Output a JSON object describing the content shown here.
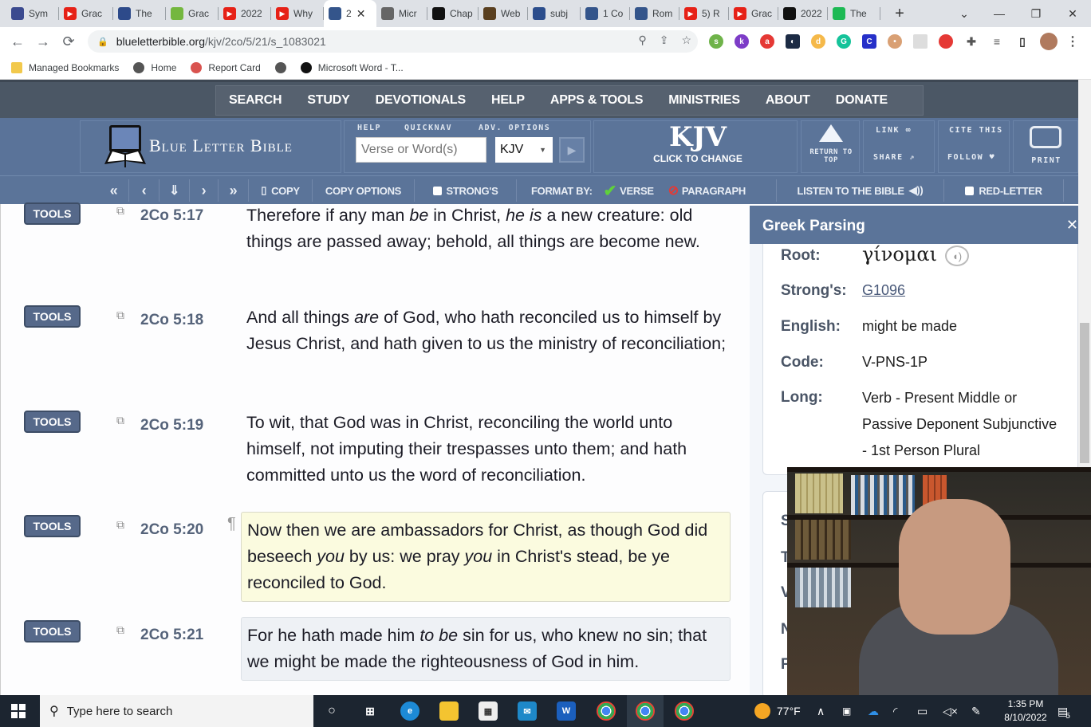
{
  "browser": {
    "tabs": [
      {
        "label": "Sym",
        "icon": "app-icon",
        "color": "#3b4a8f"
      },
      {
        "label": "Grac",
        "icon": "youtube-icon",
        "color": "#e62117"
      },
      {
        "label": "The",
        "icon": "site-icon",
        "color": "#2d4a8a"
      },
      {
        "label": "Grac",
        "icon": "rumble-icon",
        "color": "#74b73f"
      },
      {
        "label": "2022",
        "icon": "youtube-icon",
        "color": "#e62117"
      },
      {
        "label": "Why",
        "icon": "youtube-icon",
        "color": "#e62117"
      },
      {
        "label": "2",
        "icon": "blb-icon",
        "color": "#34558b",
        "active": true
      },
      {
        "label": "Micr",
        "icon": "globe-icon",
        "color": "#666"
      },
      {
        "label": "Chap",
        "icon": "doc-icon",
        "color": "#111"
      },
      {
        "label": "Web",
        "icon": "portrait-icon",
        "color": "#5a4020"
      },
      {
        "label": "subj",
        "icon": "o-icon",
        "color": "#2b4d8c"
      },
      {
        "label": "1 Co",
        "icon": "blb-icon",
        "color": "#34558b"
      },
      {
        "label": "Rom",
        "icon": "blb-icon",
        "color": "#34558b"
      },
      {
        "label": "5) R",
        "icon": "youtube-icon",
        "color": "#e62117"
      },
      {
        "label": "Grac",
        "icon": "youtube-icon",
        "color": "#e62117"
      },
      {
        "label": "2022",
        "icon": "doc-icon",
        "color": "#111"
      },
      {
        "label": "The",
        "icon": "spotify-icon",
        "color": "#1db954"
      }
    ],
    "new_tab": "+",
    "url_host": "blueletterbible.org",
    "url_path": "/kjv/2co/5/21/s_1083021",
    "bookmarks": [
      {
        "label": "Managed Bookmarks",
        "color": "#f2c94c"
      },
      {
        "label": "Home",
        "color": "#555"
      },
      {
        "label": "Report Card",
        "color": "#d9534f"
      },
      {
        "label": "",
        "color": "#555"
      },
      {
        "label": "Microsoft Word - T...",
        "color": "#111"
      }
    ]
  },
  "site": {
    "topnav": [
      "SEARCH",
      "STUDY",
      "DEVOTIONALS",
      "HELP",
      "APPS & TOOLS",
      "MINISTRIES",
      "ABOUT",
      "DONATE"
    ],
    "logo": "Blue Letter Bible",
    "search_labels": {
      "help": "HELP",
      "quicknav": "QUICKNAV",
      "adv": "ADV. OPTIONS"
    },
    "search_placeholder": "Verse or Word(s)",
    "version": "KJV",
    "version_big": "KJV",
    "click_to_change": "CLICK TO CHANGE",
    "return_top": "RETURN TO TOP",
    "link": "LINK",
    "share": "SHARE",
    "cite": "CITE THIS",
    "follow": "FOLLOW",
    "print": "PRINT",
    "toolbar": {
      "copy": "COPY",
      "copy_options": "COPY OPTIONS",
      "strongs": "STRONG'S",
      "format_by": "FORMAT BY:",
      "verse": "VERSE",
      "paragraph": "PARAGRAPH",
      "listen": "LISTEN TO THE BIBLE",
      "red_letter": "RED-LETTER"
    }
  },
  "verses": [
    {
      "tools": "TOOLS",
      "ref": "2Co 5:17",
      "html": "Therefore if any man <i>be</i> in Christ, <i>he is</i> a new creature: old things are passed away; behold, all things are become new."
    },
    {
      "tools": "TOOLS",
      "ref": "2Co 5:18",
      "html": "And all things <i>are</i> of God, who hath reconciled us to himself by Jesus Christ, and hath given to us the ministry of reconciliation;"
    },
    {
      "tools": "TOOLS",
      "ref": "2Co 5:19",
      "html": "To wit, that God was in Christ, reconciling the world unto himself, not imputing their trespasses unto them; and hath committed unto us the word of reconciliation."
    },
    {
      "tools": "TOOLS",
      "ref": "2Co 5:20",
      "html": "Now then we are ambassadors for Christ, as though God did beseech <i>you</i> by us: we pray <i>you</i> in Christ's stead, be ye reconciled to God.",
      "pilcrow": "¶"
    },
    {
      "tools": "TOOLS",
      "ref": "2Co 5:21",
      "html": "For he hath made him <i>to be</i> sin for us, who knew no sin; that we might be made the righteousness of God in him."
    }
  ],
  "panel": {
    "title": "Greek Parsing",
    "root_label": "Root:",
    "root_value": "γίνομαι",
    "strongs_label": "Strong's:",
    "strongs_value": "G1096",
    "english_label": "English:",
    "english_value": "might be made",
    "code_label": "Code:",
    "code_value": "V-PNS-1P",
    "long_label": "Long:",
    "long_lines": [
      "Verb - Present Middle or",
      "Passive Deponent Subjunctive",
      "- 1st Person Plural"
    ],
    "cut_letters": [
      "S",
      "T",
      "V",
      "N",
      "F"
    ]
  },
  "taskbar": {
    "search_placeholder": "Type here to search",
    "weather": "77°F",
    "time": "1:35 PM",
    "date": "8/10/2022",
    "notifications": "5"
  }
}
